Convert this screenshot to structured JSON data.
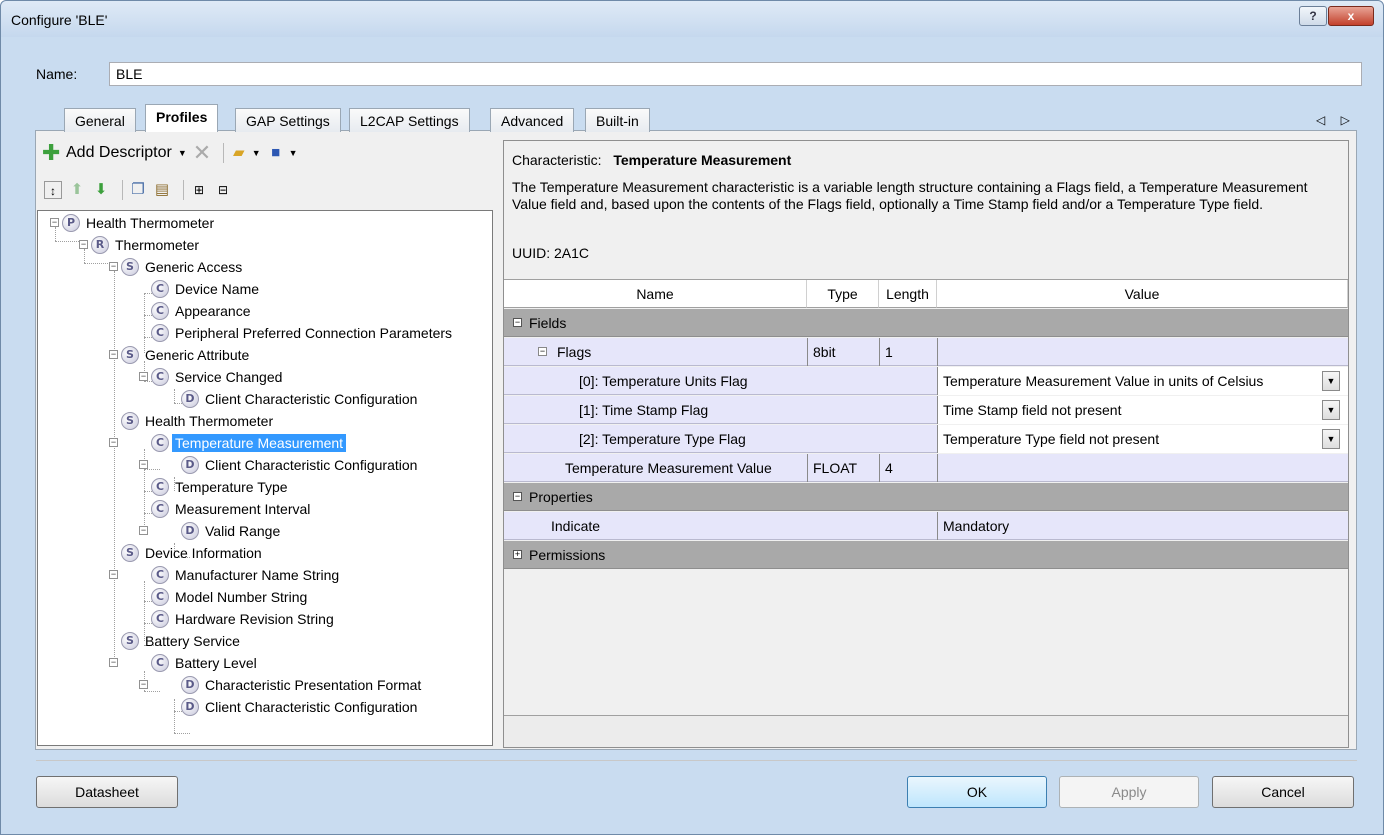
{
  "window": {
    "title": "Configure 'BLE'",
    "help_glyph": "?",
    "close_glyph": "x"
  },
  "name_field": {
    "label": "Name:",
    "value": "BLE"
  },
  "tabs": [
    {
      "label": "General"
    },
    {
      "label": "Profiles"
    },
    {
      "label": "GAP Settings"
    },
    {
      "label": "L2CAP Settings"
    },
    {
      "label": "Advanced"
    },
    {
      "label": "Built-in"
    }
  ],
  "tab_scroll": "◁ ▷",
  "toolbar": {
    "add_descriptor": "Add Descriptor"
  },
  "tree": [
    {
      "badge": "P",
      "label": "Health Thermometer"
    },
    {
      "badge": "R",
      "label": "Thermometer"
    },
    {
      "badge": "S",
      "label": "Generic Access"
    },
    {
      "badge": "C",
      "label": "Device Name"
    },
    {
      "badge": "C",
      "label": "Appearance"
    },
    {
      "badge": "C",
      "label": "Peripheral Preferred Connection Parameters"
    },
    {
      "badge": "S",
      "label": "Generic Attribute"
    },
    {
      "badge": "C",
      "label": "Service Changed"
    },
    {
      "badge": "D",
      "label": "Client Characteristic Configuration"
    },
    {
      "badge": "S",
      "label": "Health Thermometer"
    },
    {
      "badge": "C",
      "label": "Temperature Measurement"
    },
    {
      "badge": "D",
      "label": "Client Characteristic Configuration"
    },
    {
      "badge": "C",
      "label": "Temperature Type"
    },
    {
      "badge": "C",
      "label": "Measurement Interval"
    },
    {
      "badge": "D",
      "label": "Valid Range"
    },
    {
      "badge": "S",
      "label": "Device Information"
    },
    {
      "badge": "C",
      "label": "Manufacturer Name String"
    },
    {
      "badge": "C",
      "label": "Model Number String"
    },
    {
      "badge": "C",
      "label": "Hardware Revision String"
    },
    {
      "badge": "S",
      "label": "Battery Service"
    },
    {
      "badge": "C",
      "label": "Battery Level"
    },
    {
      "badge": "D",
      "label": "Characteristic Presentation Format"
    },
    {
      "badge": "D",
      "label": "Client Characteristic Configuration"
    }
  ],
  "characteristic": {
    "label": "Characteristic:",
    "name": "Temperature Measurement",
    "description": "The Temperature Measurement characteristic is a variable length structure containing a Flags field, a Temperature Measurement Value field and, based upon the contents of the Flags field, optionally a Time Stamp field and/or a Temperature Type field.",
    "uuid_label": "UUID:",
    "uuid": "2A1C"
  },
  "grid": {
    "headers": {
      "name": "Name",
      "type": "Type",
      "length": "Length",
      "value": "Value"
    },
    "fields_label": "Fields",
    "flags": {
      "name": "Flags",
      "type": "8bit",
      "length": "1"
    },
    "flag_rows": [
      {
        "name": "[0]: Temperature Units Flag",
        "value": "Temperature Measurement Value in units of Celsius"
      },
      {
        "name": "[1]: Time Stamp Flag",
        "value": "Time Stamp field not present"
      },
      {
        "name": "[2]: Temperature Type Flag",
        "value": "Temperature Type field not present"
      }
    ],
    "tmv": {
      "name": "Temperature Measurement Value",
      "type": "FLOAT",
      "length": "4"
    },
    "properties_label": "Properties",
    "indicate": {
      "name": "Indicate",
      "value": "Mandatory"
    },
    "permissions_label": "Permissions"
  },
  "buttons": {
    "datasheet": "Datasheet",
    "ok": "OK",
    "apply": "Apply",
    "cancel": "Cancel"
  }
}
